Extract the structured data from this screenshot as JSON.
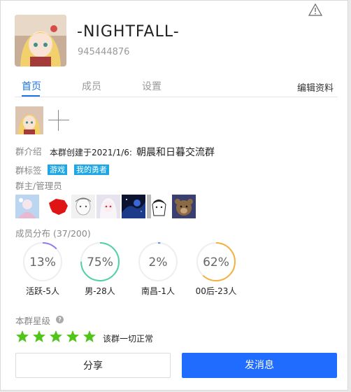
{
  "group": {
    "name": "-NIGHTFALL-",
    "id": "945444876"
  },
  "tabs": [
    {
      "label": "首页",
      "active": true
    },
    {
      "label": "成员",
      "active": false
    },
    {
      "label": "设置",
      "active": false
    }
  ],
  "edit_label": "编辑资料",
  "intro": {
    "label": "群介绍",
    "prefix": "本群创建于2021/1/6:",
    "text": "朝晨和日暮交流群"
  },
  "tags": {
    "label": "群标签",
    "items": [
      "游戏",
      "我的勇者"
    ]
  },
  "admins_label": "群主/管理员",
  "distribution": {
    "label": "成员分布 (37/200)",
    "items": [
      {
        "percent": "13%",
        "value": 13,
        "label": "活跃-5人",
        "color": "#8f7cf2"
      },
      {
        "percent": "75%",
        "value": 75,
        "label": "男-28人",
        "color": "#4fd1a0"
      },
      {
        "percent": "2%",
        "value": 2,
        "label": "南昌-1人",
        "color": "#5b8ef7"
      },
      {
        "percent": "62%",
        "value": 62,
        "label": "00后-23人",
        "color": "#f5b13d"
      }
    ]
  },
  "rating": {
    "label": "本群星级",
    "stars": 5,
    "star_color": "#52c41a",
    "status": "该群一切正常"
  },
  "buttons": {
    "share": "分享",
    "message": "发消息"
  },
  "colors": {
    "accent": "#1a73e8",
    "primary_button": "#1f6cff",
    "tag": "#1ea7e4"
  }
}
